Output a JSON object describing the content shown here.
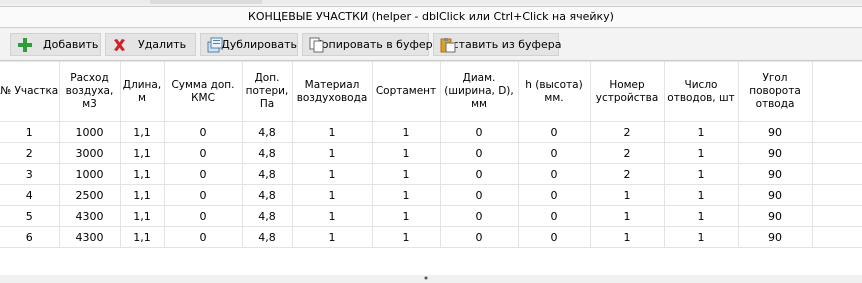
{
  "title": "КОНЦЕВЫЕ УЧАСТКИ (helper - dblClick или Ctrl+Click на ячейку)",
  "toolbar": {
    "add_label": "Добавить",
    "delete_label": "Удалить",
    "duplicate_label": "Дублировать",
    "copy_label": "Копировать в буфер",
    "paste_label": "Вставить из буфера"
  },
  "table": {
    "headers": [
      "№ Участка",
      "Расход воздуха, м3",
      "Длина, м",
      "Сумма доп. КМС",
      "Доп. потери, Па",
      "Материал воздуховода",
      "Сортамент",
      "Диам. (ширина, D), мм",
      "h (высота) мм.",
      "Номер устройства",
      "Число отводов, шт",
      "Угол поворота отвода"
    ],
    "rows": [
      [
        "1",
        "1000",
        "1,1",
        "0",
        "4,8",
        "1",
        "1",
        "0",
        "0",
        "2",
        "1",
        "90"
      ],
      [
        "2",
        "3000",
        "1,1",
        "0",
        "4,8",
        "1",
        "1",
        "0",
        "0",
        "2",
        "1",
        "90"
      ],
      [
        "3",
        "1000",
        "1,1",
        "0",
        "4,8",
        "1",
        "1",
        "0",
        "0",
        "2",
        "1",
        "90"
      ],
      [
        "4",
        "2500",
        "1,1",
        "0",
        "4,8",
        "1",
        "1",
        "0",
        "0",
        "1",
        "1",
        "90"
      ],
      [
        "5",
        "4300",
        "1,1",
        "0",
        "4,8",
        "1",
        "1",
        "0",
        "0",
        "1",
        "1",
        "90"
      ],
      [
        "6",
        "4300",
        "1,1",
        "0",
        "4,8",
        "1",
        "1",
        "0",
        "0",
        "1",
        "1",
        "90"
      ]
    ]
  },
  "icons": {
    "add": "plus-icon",
    "delete": "red-x-icon",
    "duplicate": "duplicate-icon",
    "copy": "copy-icon",
    "paste": "paste-icon"
  },
  "colors": {
    "add_icon": "#2e9d3a",
    "delete_icon": "#d0202a",
    "paste_icon": "#d9a12a"
  }
}
